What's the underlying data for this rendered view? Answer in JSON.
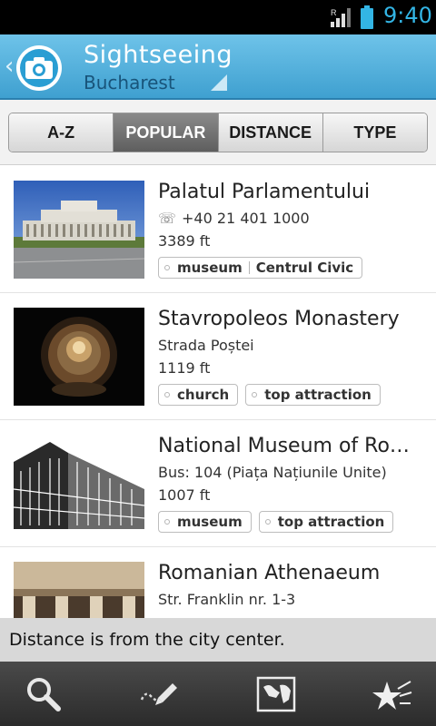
{
  "status": {
    "time": "9:40",
    "signal_label": "R"
  },
  "header": {
    "title": "Sightseeing",
    "subtitle": "Bucharest"
  },
  "tabs": [
    {
      "label": "A-Z",
      "active": false
    },
    {
      "label": "POPULAR",
      "active": true
    },
    {
      "label": "DISTANCE",
      "active": false
    },
    {
      "label": "TYPE",
      "active": false
    }
  ],
  "items": [
    {
      "name": "Palatul Parlamentului",
      "detail": "+40 21 401 1000",
      "distance": "3389 ft",
      "tags": [
        "museum",
        "Centrul Civic"
      ],
      "icon": "phone-icon",
      "image": "parliament-palace-photo"
    },
    {
      "name": "Stavropoleos Monastery",
      "detail": "Strada Poștei",
      "distance": "1119 ft",
      "tags": [
        "church",
        "top attraction"
      ],
      "image": "monastery-dome-photo"
    },
    {
      "name": "National Museum of Ro…",
      "detail": "Bus: 104 (Piața Națiunile Unite)",
      "distance": "1007 ft",
      "tags": [
        "museum",
        "top attraction"
      ],
      "image": "museum-sketch"
    },
    {
      "name": "Romanian Athenaeum",
      "detail": "Str. Franklin nr. 1-3",
      "distance": "",
      "tags": [],
      "image": "athenaeum-photo"
    }
  ],
  "info": "Distance is from the city center.",
  "toolbar": {
    "icons": [
      "search-icon",
      "draw-route-icon",
      "map-icon",
      "favorites-icon"
    ]
  }
}
